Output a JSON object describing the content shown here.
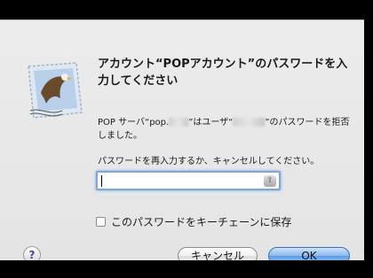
{
  "dialog": {
    "title": "アカウント“POPアカウント”のパスワードを入力してください",
    "message_part1": "POP サーバ“pop.",
    "message_part2": "”はユーザ“",
    "message_part3": "”のパスワードを拒否しました。",
    "prompt": "パスワードを再入力するか、キャンセルしてください。",
    "password_value": "",
    "save_to_keychain_label": "このパスワードをキーチェーンに保存",
    "save_to_keychain_checked": false,
    "help_label": "?",
    "cancel_label": "キャンセル",
    "ok_label": "OK"
  },
  "icons": {
    "app": "mail-stamp-eagle-icon",
    "keychain": "keychain-access-icon"
  },
  "colors": {
    "dialog_bg": "#e8e8e8",
    "focus_ring": "#6fa0e0",
    "default_button": "#6ea6e8"
  }
}
